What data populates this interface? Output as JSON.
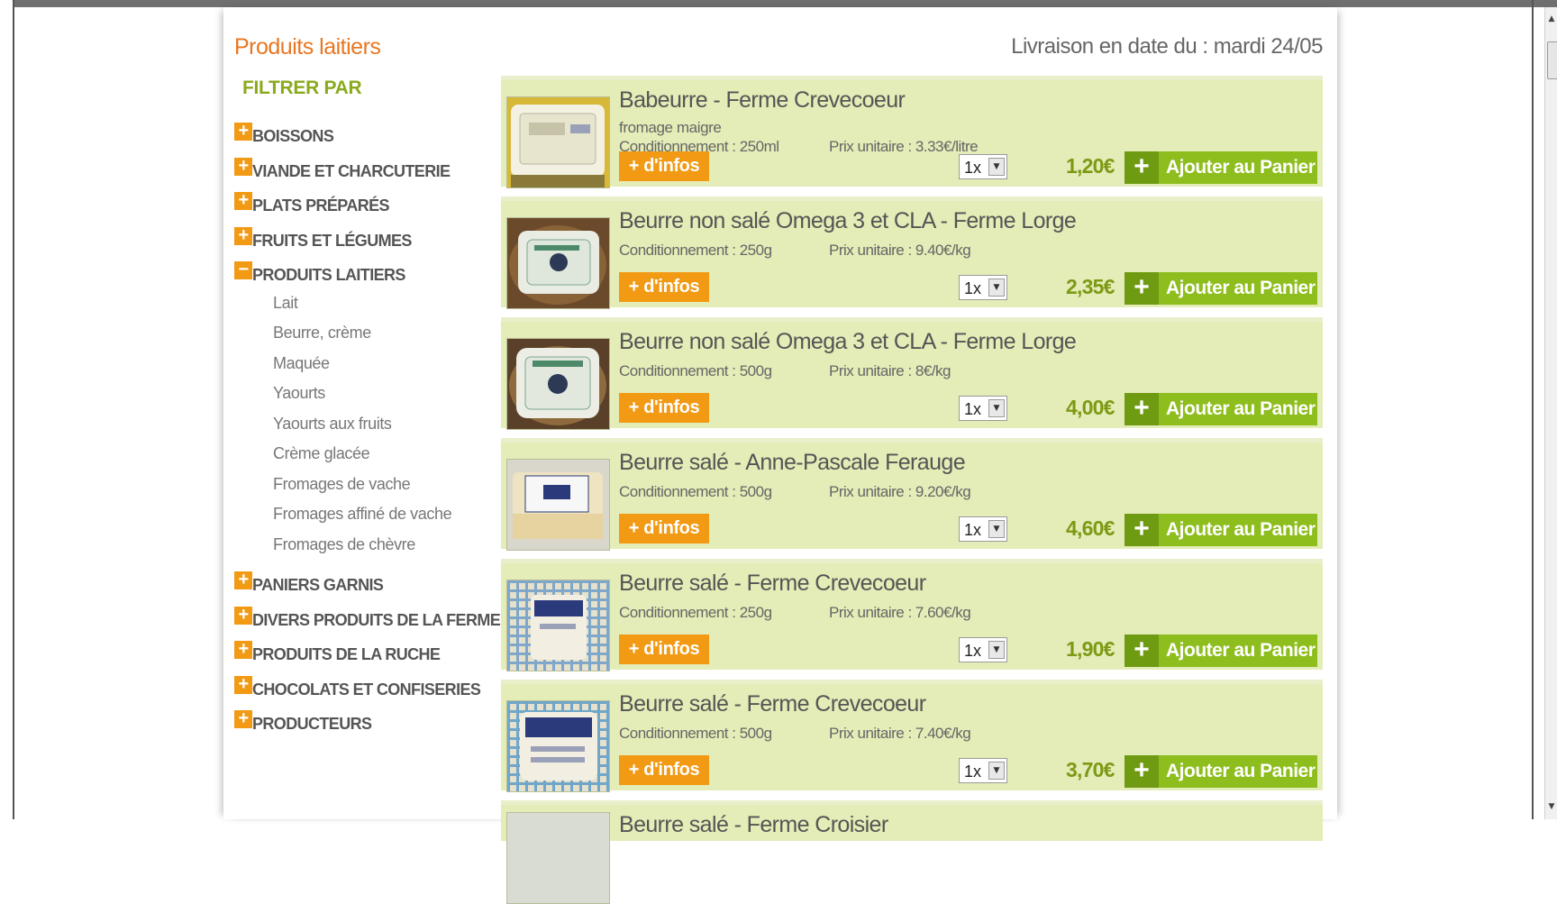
{
  "page": {
    "category_title": "Produits laitiers",
    "delivery_text": "Livraison en date du :  mardi 24/05"
  },
  "filter": {
    "title": "FILTRER PAR",
    "categories": [
      {
        "label": "BOISSONS",
        "toggle": "+"
      },
      {
        "label": "VIANDE ET CHARCUTERIE",
        "toggle": "+"
      },
      {
        "label": "PLATS PRÉPARÉS",
        "toggle": "+"
      },
      {
        "label": "FRUITS ET LÉGUMES",
        "toggle": "+"
      },
      {
        "label": "PRODUITS LAITIERS",
        "toggle": "−"
      },
      {
        "label": "PANIERS GARNIS",
        "toggle": "+"
      },
      {
        "label": "DIVERS PRODUITS DE LA FERME",
        "toggle": "+"
      },
      {
        "label": "PRODUITS DE LA RUCHE",
        "toggle": "+"
      },
      {
        "label": "CHOCOLATS ET CONFISERIES",
        "toggle": "+"
      },
      {
        "label": "PRODUCTEURS",
        "toggle": "+"
      }
    ],
    "subcategories": [
      "Lait",
      "Beurre, crème",
      "Maquée",
      "Yaourts",
      "Yaourts aux fruits",
      "Crème glacée",
      "Fromages de vache",
      "Fromages affiné de vache",
      "Fromages de chèvre"
    ]
  },
  "buttons": {
    "info_label": "+ d'infos",
    "add_label": "Ajouter au Panier",
    "add_icon": "+",
    "select_arrow": "▼"
  },
  "products": [
    {
      "name": "Babeurre - Ferme Crevecoeur",
      "description": "fromage maigre",
      "conditionnement": "Conditionnement : 250ml",
      "prix_unitaire": "Prix unitaire : 3.33€/litre",
      "qty": "1x",
      "price": "1,20€"
    },
    {
      "name": "Beurre non salé Omega 3 et CLA - Ferme Lorge",
      "description": "",
      "conditionnement": "Conditionnement : 250g",
      "prix_unitaire": "Prix unitaire : 9.40€/kg",
      "qty": "1x",
      "price": "2,35€"
    },
    {
      "name": "Beurre non salé Omega 3 et CLA - Ferme Lorge",
      "description": "",
      "conditionnement": "Conditionnement : 500g",
      "prix_unitaire": "Prix unitaire : 8€/kg",
      "qty": "1x",
      "price": "4,00€"
    },
    {
      "name": "Beurre salé - Anne-Pascale Ferauge",
      "description": "",
      "conditionnement": "Conditionnement : 500g",
      "prix_unitaire": "Prix unitaire : 9.20€/kg",
      "qty": "1x",
      "price": "4,60€"
    },
    {
      "name": "Beurre salé - Ferme Crevecoeur",
      "description": "",
      "conditionnement": "Conditionnement : 250g",
      "prix_unitaire": "Prix unitaire : 7.60€/kg",
      "qty": "1x",
      "price": "1,90€"
    },
    {
      "name": "Beurre salé - Ferme Crevecoeur",
      "description": "",
      "conditionnement": "Conditionnement : 500g",
      "prix_unitaire": "Prix unitaire : 7.40€/kg",
      "qty": "1x",
      "price": "3,70€"
    }
  ],
  "partial_product": {
    "name": "Beurre salé - Ferme Croisier"
  },
  "scrollbar": {
    "up": "▲",
    "down": "▼"
  }
}
